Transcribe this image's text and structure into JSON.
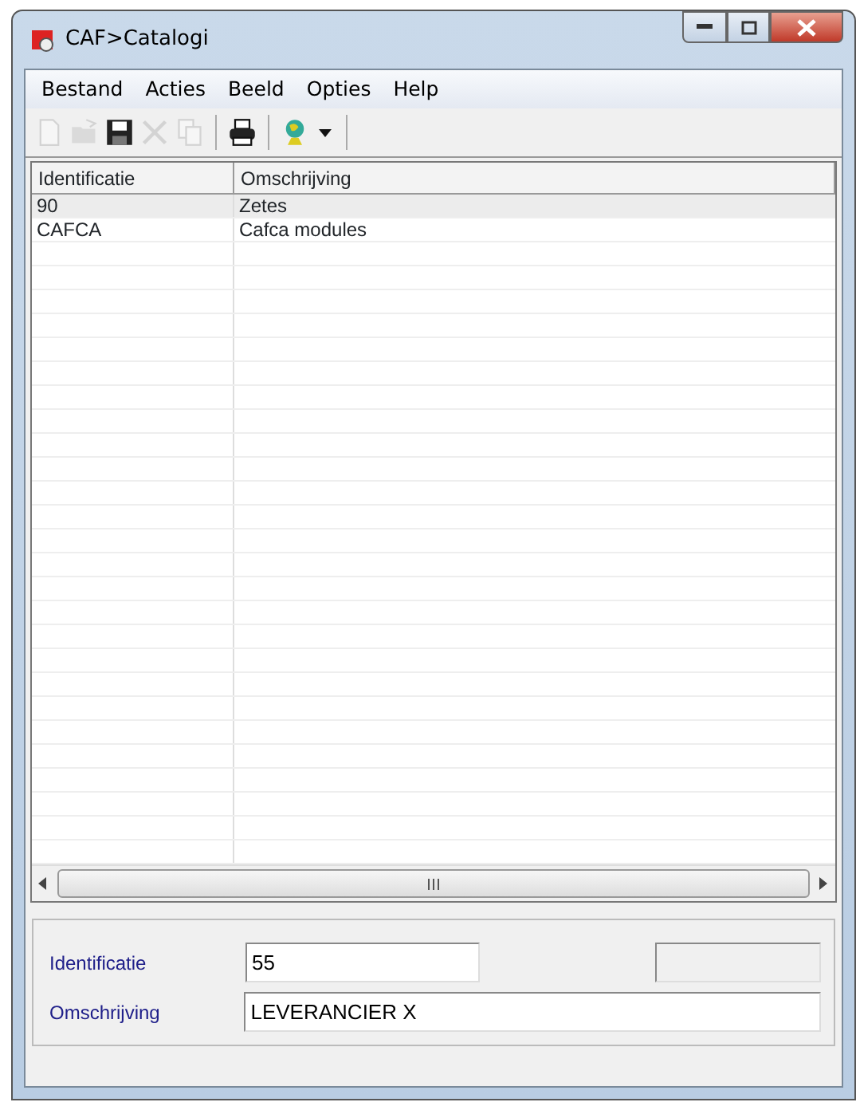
{
  "window": {
    "title": "CAF>Catalogi"
  },
  "menu": [
    {
      "label": "Bestand"
    },
    {
      "label": "Acties"
    },
    {
      "label": "Beeld"
    },
    {
      "label": "Opties"
    },
    {
      "label": "Help"
    }
  ],
  "toolbar": [
    {
      "kind": "new",
      "disabled": true
    },
    {
      "kind": "open",
      "disabled": true
    },
    {
      "kind": "save",
      "disabled": false
    },
    {
      "kind": "delete",
      "disabled": true
    },
    {
      "kind": "copy",
      "disabled": true
    },
    {
      "kind": "separator"
    },
    {
      "kind": "print",
      "disabled": false
    },
    {
      "kind": "separator"
    },
    {
      "kind": "globe",
      "disabled": false
    },
    {
      "kind": "dropdown",
      "disabled": false
    },
    {
      "kind": "separator"
    }
  ],
  "table": {
    "columns": [
      "Identificatie",
      "Omschrijving"
    ],
    "rows": [
      {
        "cells": [
          "90",
          "Zetes"
        ],
        "selected": true
      },
      {
        "cells": [
          "CAFCA",
          "Cafca modules"
        ],
        "selected": false
      }
    ]
  },
  "form": {
    "fields": [
      {
        "label": "Identificatie",
        "value": "55"
      },
      {
        "label": "Omschrijving",
        "value": "LEVERANCIER X"
      }
    ],
    "extra_field_disabled": true
  }
}
